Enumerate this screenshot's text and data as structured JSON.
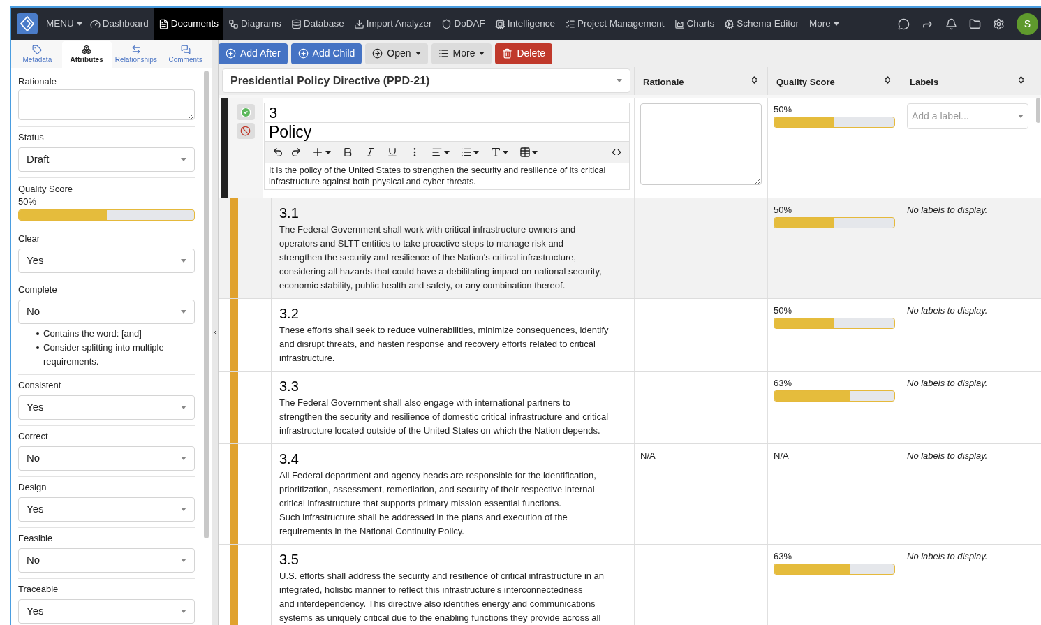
{
  "nav": {
    "menu_label": "MENU",
    "items": [
      {
        "label": "Dashboard",
        "selected": false
      },
      {
        "label": "Documents",
        "selected": true
      },
      {
        "label": "Diagrams",
        "selected": false
      },
      {
        "label": "Database",
        "selected": false
      },
      {
        "label": "Import Analyzer",
        "selected": false
      },
      {
        "label": "DoDAF",
        "selected": false
      },
      {
        "label": "Intelligence",
        "selected": false
      },
      {
        "label": "Project Management",
        "selected": false
      },
      {
        "label": "Charts",
        "selected": false
      },
      {
        "label": "Schema Editor",
        "selected": false
      }
    ],
    "more_label": "More",
    "avatar": "S"
  },
  "left_panel": {
    "tabs": [
      {
        "label": "Metadata",
        "selected": false
      },
      {
        "label": "Attributes",
        "selected": true
      },
      {
        "label": "Relationships",
        "selected": false
      },
      {
        "label": "Comments",
        "selected": false
      }
    ],
    "fields": [
      {
        "kind": "textarea",
        "label": "Rationale"
      },
      {
        "kind": "select",
        "label": "Status",
        "value": "Draft"
      },
      {
        "kind": "meter",
        "label": "Quality Score",
        "reading": "50%",
        "level": 0.5
      },
      {
        "kind": "select",
        "label": "Clear",
        "value": "Yes"
      },
      {
        "kind": "select",
        "label": "Complete",
        "value": "No",
        "notes": [
          "Contains the word: [and]",
          "Consider splitting into multiple requirements."
        ]
      },
      {
        "kind": "select",
        "label": "Consistent",
        "value": "Yes"
      },
      {
        "kind": "select",
        "label": "Correct",
        "value": "No"
      },
      {
        "kind": "select",
        "label": "Design",
        "value": "Yes"
      },
      {
        "kind": "select",
        "label": "Feasible",
        "value": "No"
      },
      {
        "kind": "select",
        "label": "Traceable",
        "value": "Yes"
      }
    ]
  },
  "toolbar": {
    "buttons": [
      {
        "label": "Add After",
        "kind": "primary",
        "has_caret": false
      },
      {
        "label": "Add Child",
        "kind": "primary",
        "has_caret": false
      },
      {
        "label": "Open",
        "kind": "secondary",
        "has_caret": true
      },
      {
        "label": "More",
        "kind": "secondary",
        "has_caret": true
      },
      {
        "label": "Delete",
        "kind": "danger",
        "has_caret": false
      }
    ]
  },
  "table": {
    "document_title": "Presidential Policy Directive (PPD-21)",
    "columns": [
      {
        "label": "Rationale"
      },
      {
        "label": "Quality Score"
      },
      {
        "label": "Labels"
      }
    ],
    "rows": [
      {
        "kind": "editing",
        "number": "3",
        "title": "Policy",
        "text": "It is the policy of the United States to strengthen the security and resilience of its critical infrastructure against both physical and cyber threats.",
        "quality": {
          "reading": "50%",
          "level": 0.5
        },
        "labels_placeholder": "Add a label..."
      },
      {
        "kind": "item",
        "highlighted": true,
        "number": "3.1",
        "text": "The Federal Government shall work with critical infrastructure owners and operators and SLTT entities to take proactive steps to manage risk and strengthen the security and resilience of the Nation's critical infrastructure, considering all hazards that could have a debilitating impact on national security, economic stability, public health and safety, or any combination thereof.",
        "quality": {
          "reading": "50%",
          "level": 0.5
        },
        "labels": "No labels to display."
      },
      {
        "kind": "item",
        "highlighted": false,
        "number": "3.2",
        "text": "These efforts shall seek to reduce vulnerabilities, minimize consequences, identify and disrupt threats, and hasten response and recovery efforts related to critical infrastructure.",
        "quality": {
          "reading": "50%",
          "level": 0.5
        },
        "labels": "No labels to display."
      },
      {
        "kind": "item",
        "highlighted": false,
        "number": "3.3",
        "text": "The Federal Government shall also engage with international partners to strengthen the security and resilience of domestic critical infrastructure and critical infrastructure located outside of the United States on which the Nation depends.",
        "quality": {
          "reading": "63%",
          "level": 0.63
        },
        "labels": "No labels to display."
      },
      {
        "kind": "item",
        "highlighted": false,
        "number": "3.4",
        "text": "All Federal department and agency heads are responsible for the identification, prioritization, assessment, remediation, and security of their respective internal critical infrastructure that supports primary mission essential functions.\nSuch infrastructure shall be addressed in the plans and execution of the requirements in the National Continuity Policy.",
        "rationale": "N/A",
        "quality": {
          "reading": "N/A"
        },
        "labels": "No labels to display."
      },
      {
        "kind": "item",
        "highlighted": false,
        "number": "3.5",
        "text": "U.S. efforts shall address the security and resilience of critical infrastructure in an integrated, holistic manner to reflect this infrastructure's interconnectedness\nand interdependency. This directive also identifies energy and communications\nsystems as uniquely critical due to the enabling functions they provide across all",
        "quality": {
          "reading": "63%",
          "level": 0.63
        },
        "labels": "No labels to display."
      }
    ]
  }
}
